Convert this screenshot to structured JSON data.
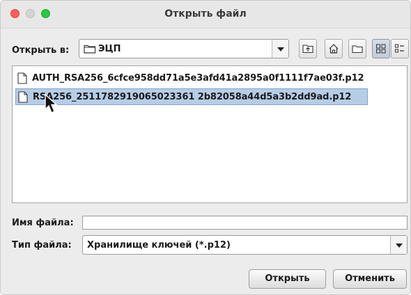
{
  "window": {
    "title": "Открыть файл"
  },
  "look_in": {
    "label": "Открыть в:",
    "value": "ЭЦП"
  },
  "toolbar": {
    "buttons": [
      {
        "icon": "folder-up-icon"
      },
      {
        "icon": "home-icon"
      },
      {
        "icon": "new-folder-icon"
      },
      {
        "icon": "list-view-icon",
        "active": true
      },
      {
        "icon": "details-view-icon"
      }
    ]
  },
  "files": [
    {
      "name": "AUTH_RSA256_6cfce958dd71a5e3afd41a2895a0f1111f7ae03f.p12",
      "selected": false
    },
    {
      "name": "RSA256_2511782919065023361 2b82058a44d5a3b2dd9ad.p12",
      "selected": true
    }
  ],
  "file_name": {
    "label": "Имя файла:",
    "value": ""
  },
  "file_type": {
    "label": "Тип файла:",
    "value": "Хранилище ключей (*.p12)"
  },
  "actions": {
    "open": "Открыть",
    "cancel": "Отменить"
  },
  "colors": {
    "selection": "#b6cde6",
    "close": "#fe5f57",
    "maximize": "#28c840"
  }
}
